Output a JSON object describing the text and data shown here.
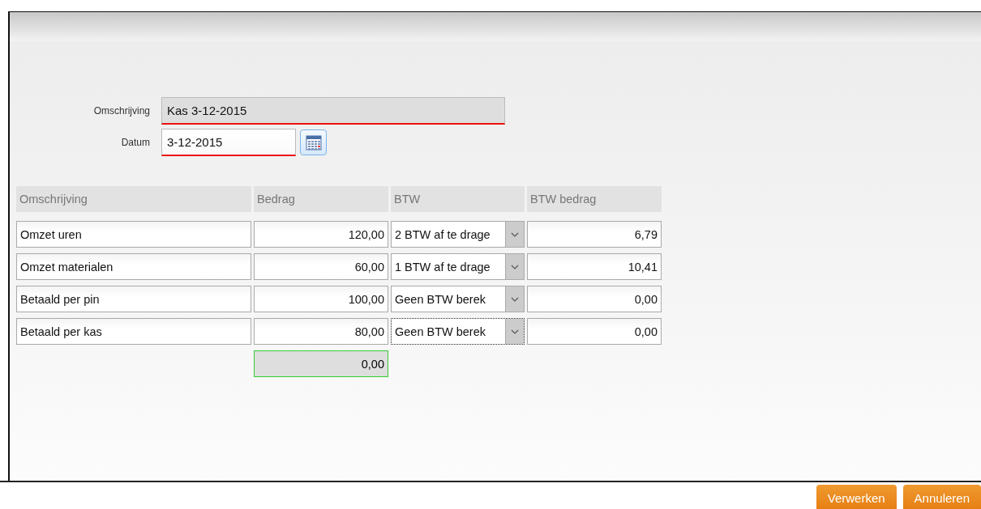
{
  "form": {
    "fields": [
      {
        "label": "Omschrijving",
        "value": "Kas 3-12-2015",
        "readonly": true,
        "invalid": true
      },
      {
        "label": "Datum",
        "value": "3-12-2015",
        "readonly": false,
        "invalid": true
      }
    ]
  },
  "table": {
    "columns": [
      "Omschrijving",
      "Bedrag",
      "BTW",
      "BTW bedrag"
    ],
    "rows": [
      {
        "omschrijving": "Omzet uren",
        "bedrag": "120,00",
        "btw": "2 BTW af te drage",
        "btw_bedrag": "6,79",
        "focused": false
      },
      {
        "omschrijving": "Omzet materialen",
        "bedrag": "60,00",
        "btw": "1 BTW af te drage",
        "btw_bedrag": "10,41",
        "focused": false
      },
      {
        "omschrijving": "Betaald per pin",
        "bedrag": "100,00",
        "btw": "Geen BTW berek",
        "btw_bedrag": "0,00",
        "focused": false
      },
      {
        "omschrijving": "Betaald per kas",
        "bedrag": "80,00",
        "btw": "Geen BTW berek",
        "btw_bedrag": "0,00",
        "focused": true
      }
    ],
    "total": {
      "value": "0,00",
      "valid": true
    }
  },
  "buttons": [
    "Verwerken",
    "Annuleren"
  ]
}
